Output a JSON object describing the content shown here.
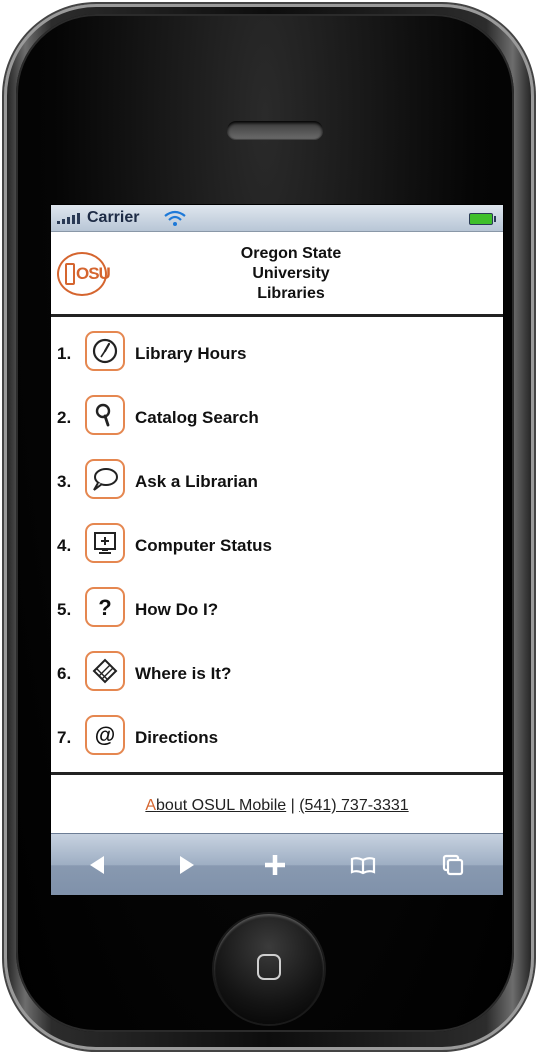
{
  "status_bar": {
    "carrier": "Carrier"
  },
  "header": {
    "logo_text": "OSU",
    "title_line1": "Oregon State",
    "title_line2": "University",
    "title_line3": "Libraries"
  },
  "menu": {
    "items": [
      {
        "number": "1.",
        "label": "Library Hours",
        "icon": "clock-icon"
      },
      {
        "number": "2.",
        "label": "Catalog Search",
        "icon": "magnifier-icon"
      },
      {
        "number": "3.",
        "label": "Ask a Librarian",
        "icon": "speech-bubble-icon"
      },
      {
        "number": "4.",
        "label": "Computer Status",
        "icon": "computer-monitor-icon"
      },
      {
        "number": "5.",
        "label": "How Do I?",
        "icon": "question-mark-icon"
      },
      {
        "number": "6.",
        "label": "Where is It?",
        "icon": "map-icon"
      },
      {
        "number": "7.",
        "label": "Directions",
        "icon": "at-sign-icon"
      }
    ]
  },
  "footer": {
    "about_first_letter": "A",
    "about_rest": "bout OSUL Mobile",
    "separator": " | ",
    "phone": "(541) 737-3331"
  },
  "toolbar": {
    "buttons": [
      "back-arrow-icon",
      "forward-arrow-icon",
      "add-icon",
      "bookmarks-icon",
      "pages-icon"
    ]
  },
  "colors": {
    "accent": "#e58750",
    "osu_orange": "#d5652f"
  }
}
